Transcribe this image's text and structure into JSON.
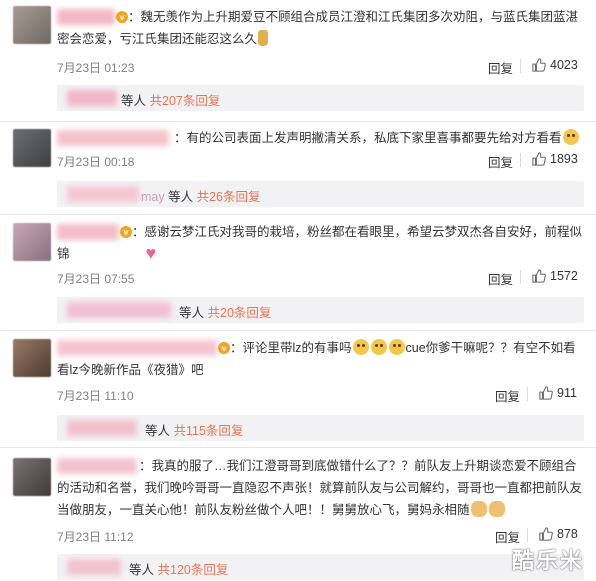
{
  "comments": [
    {
      "text": "：魏无羡作为上升期爱豆不顾组合成员江澄和江氏集团多次劝阻，与蓝氏集团蓝湛密会恋爱，亏江氏集团还能忍这么久",
      "date": "7月23日 01:23",
      "reply_label": "回复",
      "likes": "4023",
      "sub_suffix": "等人",
      "sub_count": "共207条回复"
    },
    {
      "text": "：有的公司表面上发声明撇清关系，私底下家里喜事都要先给对方看看",
      "date": "7月23日 00:18",
      "reply_label": "回复",
      "likes": "1893",
      "sub_name_partial": "may",
      "sub_suffix": "等人",
      "sub_count": "共26条回复"
    },
    {
      "text": "：感谢云梦江氏对我哥的栽培，粉丝都在看眼里，希望云梦双杰各自安好，前程似锦",
      "date": "7月23日 07:55",
      "reply_label": "回复",
      "likes": "1572",
      "sub_suffix": "等人",
      "sub_count": "共20条回复"
    },
    {
      "text_a": "：评论里带lz的有事吗",
      "text_b": "cue你爹干嘛呢？？有空不如看看lz今晚新作品《夜猎》吧",
      "date": "7月23日 11:10",
      "reply_label": "回复",
      "likes": "911",
      "sub_suffix": "等人",
      "sub_count": "共115条回复"
    },
    {
      "text": "：我真的服了…我们江澄哥哥到底做错什么了？？前队友上升期谈恋爱不顾组合的活动和名誉，我们晚吟哥哥一直隐忍不声张！就算前队友与公司解约，哥哥也一直都把前队友当做朋友，一直关心他！前队友粉丝做个人吧！！舅舅放心飞，舅妈永相随",
      "date": "7月23日 11:12",
      "reply_label": "回复",
      "likes": "878",
      "sub_suffix": "等人",
      "sub_count": "共120条回复"
    }
  ],
  "watermark": "酷乐米",
  "colors": {
    "count_accent": "#eb7350",
    "date_gray": "#808080",
    "sub_bg": "#f2f2f5"
  },
  "icons": [
    "thumbs-up-icon",
    "vip-badge-icon",
    "emoji-icon"
  ]
}
